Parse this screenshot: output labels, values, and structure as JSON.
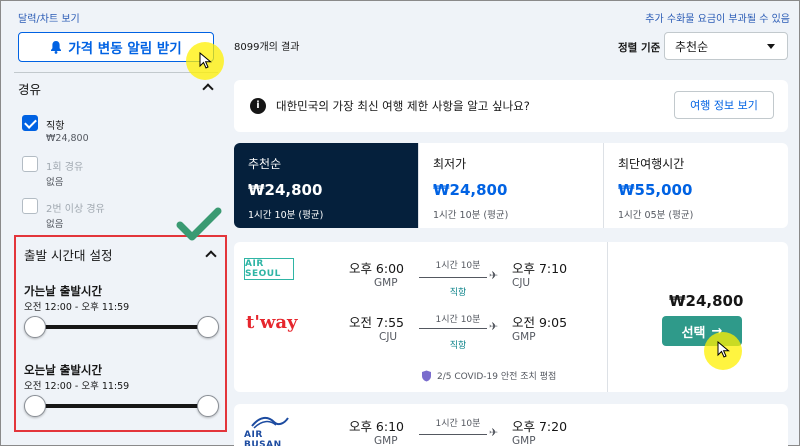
{
  "top": {
    "calendar_link": "달력/차트 보기",
    "fee_notice": "추가 수화물 요금이 부과될 수 있음"
  },
  "alert": {
    "label": "가격 변동 알림 받기",
    "icon": "bell-icon"
  },
  "results": {
    "count": "8099개의 결과"
  },
  "sort": {
    "label": "정렬 기준",
    "value": "추천순"
  },
  "stops": {
    "title": "경유",
    "options": [
      {
        "label": "직항",
        "sub": "₩24,800",
        "checked": true
      },
      {
        "label": "1회 경유",
        "sub": "없음",
        "checked": false
      },
      {
        "label": "2번 이상 경유",
        "sub": "없음",
        "checked": false
      }
    ]
  },
  "departure": {
    "title": "출발 시간대 설정",
    "outbound": {
      "title": "가는날 출발시간",
      "range": "오전 12:00 - 오후 11:59",
      "min": 0,
      "max": 1
    },
    "inbound": {
      "title": "오는날 출발시간",
      "range": "오전 12:00 - 오후 11:59",
      "min": 0,
      "max": 1
    }
  },
  "banner": {
    "text": "대한민국의 가장 최신 여행 제한 사항을 알고 싶나요?",
    "button": "여행 정보 보기"
  },
  "tabs": [
    {
      "label": "추천순",
      "price": "₩24,800",
      "time": "1시간 10분 (평균)",
      "active": true
    },
    {
      "label": "최저가",
      "price": "₩24,800",
      "time": "1시간 10분 (평균)",
      "active": false
    },
    {
      "label": "최단여행시간",
      "price": "₩55,000",
      "time": "1시간 05분 (평균)",
      "active": false
    }
  ],
  "card1": {
    "legs": [
      {
        "airline": "AIR SEOUL",
        "dep_time": "오후 6:00",
        "dep_code": "GMP",
        "duration": "1시간 10분",
        "stops": "직항",
        "arr_time": "오후 7:10",
        "arr_code": "CJU"
      },
      {
        "airline": "t'way",
        "dep_time": "오전 7:55",
        "dep_code": "CJU",
        "duration": "1시간 10분",
        "stops": "직항",
        "arr_time": "오전 9:05",
        "arr_code": "GMP"
      }
    ],
    "covid": "2/5 COVID-19 안전 조치 평점",
    "price": "₩24,800",
    "select": "선택"
  },
  "card2": {
    "airline": "AIR BUSAN",
    "dep_time": "오후 6:10",
    "dep_code": "GMP",
    "duration": "1시간 10분",
    "arr_time": "오후 7:20",
    "arr_code": "GMP"
  },
  "colors": {
    "accent": "#0062e3",
    "dark_tab": "#05203c",
    "select": "#2f9a8a",
    "highlight": "#e3353b"
  }
}
